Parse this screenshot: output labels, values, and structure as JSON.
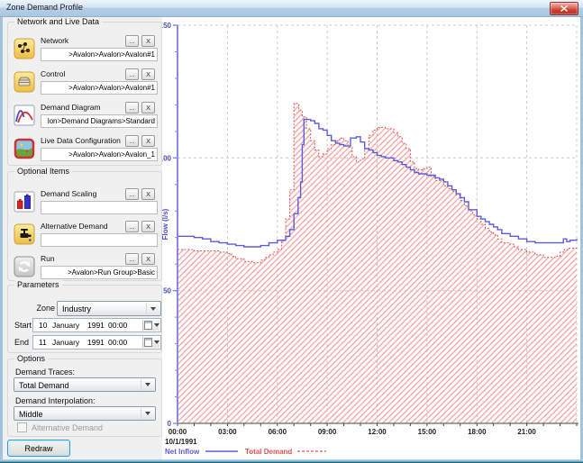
{
  "window": {
    "title": "Zone Demand Profile"
  },
  "ui": {
    "browse_label": "...",
    "remove_label": "X"
  },
  "network_group": {
    "title": "Network and Live Data",
    "items": [
      {
        "label": "Network",
        "value": ">Avalon>Avalon>Avalon#1",
        "icon": "network-icon"
      },
      {
        "label": "Control",
        "value": ">Avalon>Avalon>Avalon#1",
        "icon": "control-icon"
      },
      {
        "label": "Demand Diagram",
        "value": "lon>Demand Diagrams>Standard",
        "icon": "demand-diagram-icon"
      },
      {
        "label": "Live Data Configuration",
        "value": ">Avalon>Avalon>Avalon_1",
        "icon": "live-data-configuration-icon"
      }
    ]
  },
  "optional_group": {
    "title": "Optional Items",
    "items": [
      {
        "label": "Demand Scaling",
        "value": "",
        "icon": "demand-scaling-icon"
      },
      {
        "label": "Alternative Demand",
        "value": "",
        "icon": "alternative-demand-icon"
      },
      {
        "label": "Run",
        "value": ">Avalon>Run Group>Basic",
        "icon": "run-icon"
      }
    ]
  },
  "parameters": {
    "title": "Parameters",
    "zone_label": "Zone",
    "zone_value": "Industry",
    "start_label": "Start",
    "start": {
      "day": "10",
      "month": "January",
      "year": "1991",
      "time": "00:00"
    },
    "end_label": "End",
    "end": {
      "day": "11",
      "month": "January",
      "year": "1991",
      "time": "00:00"
    }
  },
  "options": {
    "title": "Options",
    "traces_label": "Demand Traces:",
    "traces_value": "Total Demand",
    "interpolation_label": "Demand Interpolation:",
    "interpolation_value": "Middle",
    "alternative_demand_label": "Alternative Demand",
    "alternative_demand_checked": false
  },
  "redraw_label": "Redraw",
  "chart_data": {
    "type": "line",
    "title": "",
    "ylabel": "Flow (l/s)",
    "date_label": "10/1/1991",
    "xlim_hours": [
      0,
      24
    ],
    "ylim": [
      0,
      150
    ],
    "grid": true,
    "legend_position": "bottom-left",
    "y_ticks": [
      0,
      50,
      100,
      150
    ],
    "y_tick_labels": [
      "0",
      "50",
      "100",
      "150"
    ],
    "x_tick_hours": [
      0,
      3,
      6,
      9,
      12,
      15,
      18,
      21
    ],
    "x_tick_labels": [
      "00:00",
      "03:00",
      "06:00",
      "09:00",
      "12:00",
      "15:00",
      "18:00",
      "21:00"
    ],
    "colors": {
      "net_inflow": "#5c5cd8",
      "total_demand": "#e25252",
      "hatch_fill": "#f0a2a2",
      "y_axis": "#8a8ae2",
      "y_label": "#4d4dd0",
      "x_axis": "#444444",
      "x_label": "#222222",
      "grid": "#cccccc"
    },
    "legend": [
      {
        "name": "Net Inflow",
        "style": "solid"
      },
      {
        "name": "Total Demand",
        "style": "dashed-hatched-area"
      }
    ],
    "series": [
      {
        "name": "Net Inflow",
        "style": "solid-step-line",
        "color": "#5c5cd8",
        "points": [
          [
            0,
            70.5
          ],
          [
            1,
            70
          ],
          [
            1.5,
            69.5
          ],
          [
            2,
            68.5
          ],
          [
            2.5,
            68
          ],
          [
            3,
            67.5
          ],
          [
            3.5,
            67
          ],
          [
            4,
            66.5
          ],
          [
            5,
            67
          ],
          [
            5.5,
            68
          ],
          [
            6,
            69
          ],
          [
            6.5,
            70.5
          ],
          [
            6.75,
            73
          ],
          [
            7,
            79
          ],
          [
            7.25,
            85
          ],
          [
            7.4,
            91
          ],
          [
            7.5,
            105
          ],
          [
            7.6,
            114.5
          ],
          [
            8,
            114
          ],
          [
            8.25,
            113
          ],
          [
            8.5,
            111
          ],
          [
            8.75,
            110.5
          ],
          [
            9,
            108.5
          ],
          [
            9.25,
            106.5
          ],
          [
            9.5,
            105.5
          ],
          [
            9.75,
            105
          ],
          [
            10,
            104.5
          ],
          [
            10.4,
            107.5
          ],
          [
            10.75,
            108
          ],
          [
            11,
            106
          ],
          [
            11.25,
            103.5
          ],
          [
            11.5,
            103
          ],
          [
            11.75,
            102
          ],
          [
            12,
            101
          ],
          [
            12.25,
            100.5
          ],
          [
            12.5,
            100
          ],
          [
            13,
            99
          ],
          [
            13.25,
            98.5
          ],
          [
            13.5,
            97.5
          ],
          [
            13.75,
            96.5
          ],
          [
            14,
            95.5
          ],
          [
            14.25,
            94.5
          ],
          [
            14.5,
            94
          ],
          [
            15,
            93.5
          ],
          [
            15.5,
            92.5
          ],
          [
            15.75,
            92
          ],
          [
            16,
            91
          ],
          [
            16.25,
            89.5
          ],
          [
            16.5,
            88
          ],
          [
            16.75,
            86.5
          ],
          [
            17,
            85
          ],
          [
            17.25,
            83.5
          ],
          [
            17.5,
            80.5
          ],
          [
            18,
            78
          ],
          [
            18.25,
            77
          ],
          [
            18.5,
            76
          ],
          [
            18.75,
            75
          ],
          [
            19,
            74
          ],
          [
            19.25,
            73
          ],
          [
            19.5,
            71.5
          ],
          [
            20,
            70.5
          ],
          [
            20.5,
            69.5
          ],
          [
            21,
            68.5
          ],
          [
            21.5,
            68
          ],
          [
            23,
            68
          ],
          [
            23.2,
            69.5
          ],
          [
            23.4,
            68.5
          ],
          [
            23.6,
            69
          ],
          [
            24,
            69.5
          ]
        ]
      },
      {
        "name": "Total Demand",
        "style": "hatched-area-dotted-step",
        "color": "#e25252",
        "points": [
          [
            0,
            65.5
          ],
          [
            1,
            65
          ],
          [
            2,
            65
          ],
          [
            2.5,
            64.5
          ],
          [
            3,
            64
          ],
          [
            3.25,
            63
          ],
          [
            3.5,
            62
          ],
          [
            4,
            61
          ],
          [
            4.5,
            60.5
          ],
          [
            5,
            61.5
          ],
          [
            5.25,
            62.5
          ],
          [
            5.5,
            63.5
          ],
          [
            5.75,
            64.5
          ],
          [
            6,
            65.5
          ],
          [
            6.25,
            69
          ],
          [
            6.5,
            77
          ],
          [
            6.75,
            88
          ],
          [
            7,
            120.5
          ],
          [
            7.3,
            118
          ],
          [
            7.5,
            115.5
          ],
          [
            7.75,
            111
          ],
          [
            8,
            106.5
          ],
          [
            8.25,
            103
          ],
          [
            8.5,
            100.5
          ],
          [
            8.75,
            101.5
          ],
          [
            9,
            103.5
          ],
          [
            9.25,
            105
          ],
          [
            9.5,
            106.5
          ],
          [
            9.75,
            107.5
          ],
          [
            10,
            106.5
          ],
          [
            10.25,
            104
          ],
          [
            10.5,
            100.5
          ],
          [
            10.75,
            98.5
          ],
          [
            11,
            99.5
          ],
          [
            11.25,
            103.5
          ],
          [
            11.5,
            108.5
          ],
          [
            11.75,
            110.5
          ],
          [
            12,
            111.5
          ],
          [
            12.5,
            111
          ],
          [
            13,
            109.5
          ],
          [
            13.25,
            108
          ],
          [
            13.5,
            105.5
          ],
          [
            13.75,
            103.5
          ],
          [
            14,
            98.5
          ],
          [
            14.25,
            96
          ],
          [
            14.5,
            95.5
          ],
          [
            14.75,
            96
          ],
          [
            15,
            96.5
          ],
          [
            15.25,
            93
          ],
          [
            15.5,
            91.5
          ],
          [
            16,
            89.5
          ],
          [
            16.25,
            88.5
          ],
          [
            16.5,
            87.5
          ],
          [
            16.75,
            86
          ],
          [
            17,
            84
          ],
          [
            17.25,
            82
          ],
          [
            17.5,
            80
          ],
          [
            17.75,
            78.5
          ],
          [
            18,
            77
          ],
          [
            18.25,
            75
          ],
          [
            18.5,
            73.5
          ],
          [
            18.75,
            72
          ],
          [
            19,
            71
          ],
          [
            19.25,
            69.5
          ],
          [
            19.5,
            68
          ],
          [
            20,
            67.5
          ],
          [
            20.25,
            66.5
          ],
          [
            20.5,
            65.5
          ],
          [
            21,
            64.5
          ],
          [
            21.5,
            63.5
          ],
          [
            22,
            62.5
          ],
          [
            22.75,
            63
          ],
          [
            23,
            64.5
          ],
          [
            23.25,
            65.5
          ],
          [
            23.5,
            66
          ],
          [
            24,
            66.5
          ]
        ]
      }
    ]
  }
}
